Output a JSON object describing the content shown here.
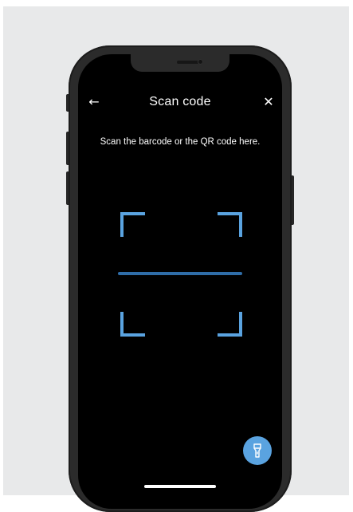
{
  "header": {
    "back_icon": "arrow-left-icon",
    "back_glyph": "←",
    "title": "Scan code",
    "close_icon": "close-icon",
    "close_glyph": "✕"
  },
  "instruction": "Scan the barcode or the QR code here.",
  "scanner": {
    "frame_color": "#5aa3e0",
    "line_color": "#2f6da8"
  },
  "flashlight": {
    "icon": "flashlight-icon",
    "color": "#5aa3e0"
  },
  "colors": {
    "screen_background": "#000000",
    "page_background": "#e8e9ea",
    "device_frame": "#2b2b2b",
    "text": "#ffffff"
  }
}
